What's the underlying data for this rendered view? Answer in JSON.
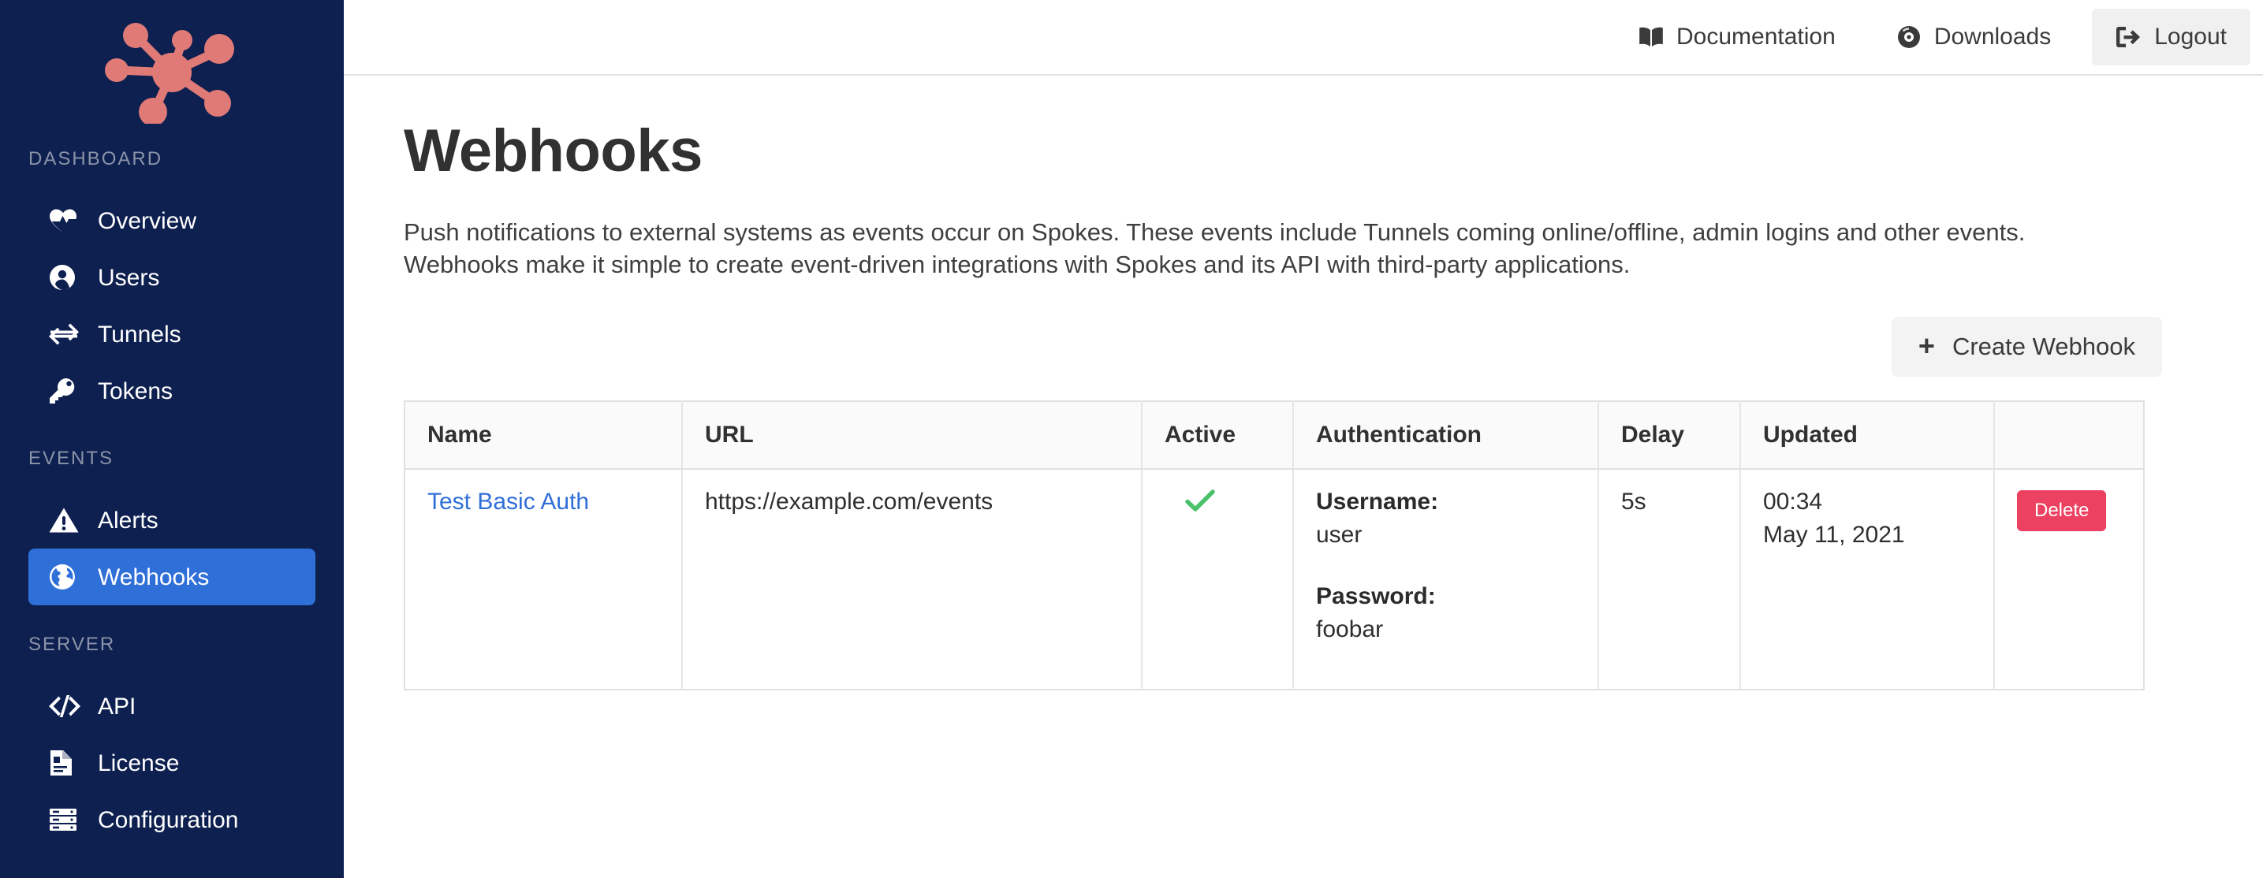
{
  "sidebar": {
    "logo_name": "spokes-hub-logo",
    "logo_color": "#e07a77",
    "background_color": "#0e2050",
    "active_color": "#2f6fd8",
    "sections": [
      {
        "label": "DASHBOARD",
        "items": [
          {
            "label": "Overview",
            "icon": "heartbeat-icon",
            "active": false
          },
          {
            "label": "Users",
            "icon": "user-circle-icon",
            "active": false
          },
          {
            "label": "Tunnels",
            "icon": "exchange-arrows-icon",
            "active": false
          },
          {
            "label": "Tokens",
            "icon": "key-icon",
            "active": false
          }
        ]
      },
      {
        "label": "EVENTS",
        "items": [
          {
            "label": "Alerts",
            "icon": "warning-triangle-icon",
            "active": false
          },
          {
            "label": "Webhooks",
            "icon": "globe-icon",
            "active": true
          }
        ]
      },
      {
        "label": "SERVER",
        "items": [
          {
            "label": "API",
            "icon": "code-brackets-icon",
            "active": false
          },
          {
            "label": "License",
            "icon": "document-icon",
            "active": false
          },
          {
            "label": "Configuration",
            "icon": "server-racks-icon",
            "active": false
          }
        ]
      }
    ]
  },
  "topbar": {
    "links": [
      {
        "label": "Documentation",
        "icon": "book-icon"
      },
      {
        "label": "Downloads",
        "icon": "compact-disc-icon"
      },
      {
        "label": "Logout",
        "icon": "sign-out-icon"
      }
    ]
  },
  "page": {
    "title": "Webhooks",
    "description": "Push notifications to external systems as events occur on Spokes. These events include Tunnels coming online/offline, admin logins and other events. Webhooks make it simple to create event-driven integrations with Spokes and its API with third-party applications."
  },
  "actions": {
    "create_label": "Create Webhook",
    "create_icon": "plus-icon"
  },
  "table": {
    "columns": [
      "Name",
      "URL",
      "Active",
      "Authentication",
      "Delay",
      "Updated",
      ""
    ],
    "rows": [
      {
        "name": "Test Basic Auth",
        "url": "https://example.com/events",
        "active": true,
        "active_icon": "check-icon",
        "auth": {
          "username_label": "Username:",
          "username_value": "user",
          "password_label": "Password:",
          "password_value": "foobar"
        },
        "delay": "5s",
        "updated_time": "00:34",
        "updated_date": "May 11, 2021",
        "delete_label": "Delete"
      }
    ]
  },
  "colors": {
    "accent_blue": "#2f6fd8",
    "delete_red": "#ec4160",
    "check_green": "#4cc16c",
    "sidebar_navy": "#0e2050",
    "logo_coral": "#e07a77"
  }
}
